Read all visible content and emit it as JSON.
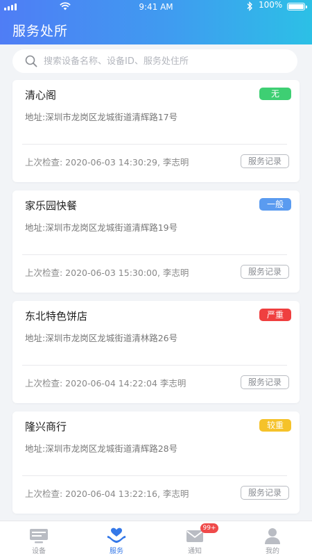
{
  "status_bar": {
    "time": "9:41 AM",
    "battery_percent": "100%",
    "battery_level": 1.0
  },
  "header": {
    "title": "服务处所"
  },
  "search": {
    "placeholder": "搜索设备名称、设备ID、服务处住所"
  },
  "colors": {
    "header_gradient": [
      "#4f7df5",
      "#2cc0e6"
    ],
    "accent": "#3478e8",
    "badge_none": "#3ecf73",
    "badge_normal": "#5a9bf0",
    "badge_severe": "#ef3f3f",
    "badge_moderate": "#f5c22a"
  },
  "cards": [
    {
      "name": "清心阁",
      "badge": "无",
      "badge_color": "#3ecf73",
      "address": "地址:深圳市龙岗区龙城街道清辉路17号",
      "last_check": "上次检查: 2020-06-03 14:30:29,  李志明",
      "record_button": "服务记录"
    },
    {
      "name": "家乐园快餐",
      "badge": "一般",
      "badge_color": "#5a9bf0",
      "address": "地址:深圳市龙岗区龙城街道清辉路19号",
      "last_check": "上次检查: 2020-06-03 15:30:00,  李志明",
      "record_button": "服务记录"
    },
    {
      "name": "东北特色饼店",
      "badge": "严重",
      "badge_color": "#ef3f3f",
      "address": "地址:深圳市龙岗区龙城街道清林路26号",
      "last_check": "上次检查: 2020-06-04 14:22:04   李志明",
      "record_button": "服务记录"
    },
    {
      "name": "隆兴商行",
      "badge": "较重",
      "badge_color": "#f5c22a",
      "address": "地址:深圳市龙岗区龙城街道清辉路28号",
      "last_check": "上次检查: 2020-06-04 13:22:16,  李志明",
      "record_button": "服务记录"
    }
  ],
  "tabbar": {
    "tabs": [
      {
        "label": "设备",
        "icon": "device-icon"
      },
      {
        "label": "服务",
        "icon": "heart-hand-icon",
        "active": true
      },
      {
        "label": "通知",
        "icon": "mail-icon",
        "badge": "99+"
      },
      {
        "label": "我的",
        "icon": "user-icon"
      }
    ]
  }
}
